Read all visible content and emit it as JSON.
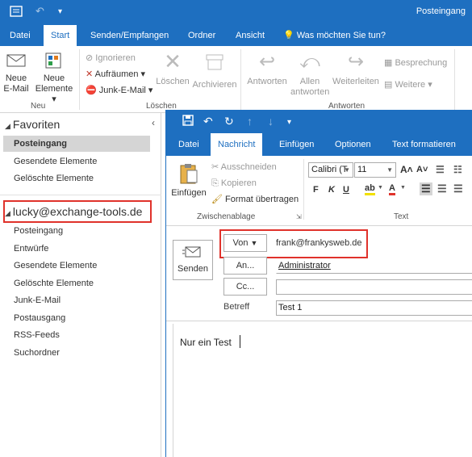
{
  "main": {
    "title": "Posteingang",
    "tabs": [
      "Datei",
      "Start",
      "Senden/Empfangen",
      "Ordner",
      "Ansicht"
    ],
    "tell_me": "Was möchten Sie tun?",
    "ribbon": {
      "new_email": [
        "Neue",
        "E-Mail"
      ],
      "new_items": [
        "Neue",
        "Elemente ▾"
      ],
      "group_new": "Neu",
      "ignore": "Ignorieren",
      "cleanup": "Aufräumen ▾",
      "junk": "Junk-E-Mail ▾",
      "delete": "Löschen",
      "archive": "Archivieren",
      "group_delete": "Löschen",
      "reply": "Antworten",
      "reply_all": [
        "Allen",
        "antworten"
      ],
      "forward": "Weiterleiten",
      "meeting": "Besprechung",
      "more": "Weitere ▾",
      "group_respond": "Antworten"
    }
  },
  "nav": {
    "favorites_header": "Favoriten",
    "favorites": [
      "Posteingang",
      "Gesendete Elemente",
      "Gelöschte Elemente"
    ],
    "account_header": "lucky@exchange-tools.de",
    "account_items": [
      "Posteingang",
      "Entwürfe",
      "Gesendete Elemente",
      "Gelöschte Elemente",
      "Junk-E-Mail",
      "Postausgang",
      "RSS-Feeds",
      "Suchordner"
    ]
  },
  "compose": {
    "tabs": [
      "Datei",
      "Nachricht",
      "Einfügen",
      "Optionen",
      "Text formatieren"
    ],
    "clipboard": {
      "paste": "Einfügen",
      "cut": "Ausschneiden",
      "copy": "Kopieren",
      "format_painter": "Format übertragen",
      "group": "Zwischenablage"
    },
    "text_group": {
      "font": "Calibri (T",
      "size": "11",
      "bold": "F",
      "italic": "K",
      "underline": "U",
      "group": "Text"
    },
    "send": "Senden",
    "from_label": "Von",
    "from_value": "frank@frankysweb.de",
    "to_label": "An...",
    "to_value": "Administrator",
    "cc_label": "Cc...",
    "cc_value": "",
    "subject_label": "Betreff",
    "subject_value": "Test 1",
    "body": "Nur ein Test"
  },
  "colors": {
    "accent": "#1e6fc0",
    "highlight_box": "#e0322b",
    "selected_bg": "#d5d5d5"
  }
}
